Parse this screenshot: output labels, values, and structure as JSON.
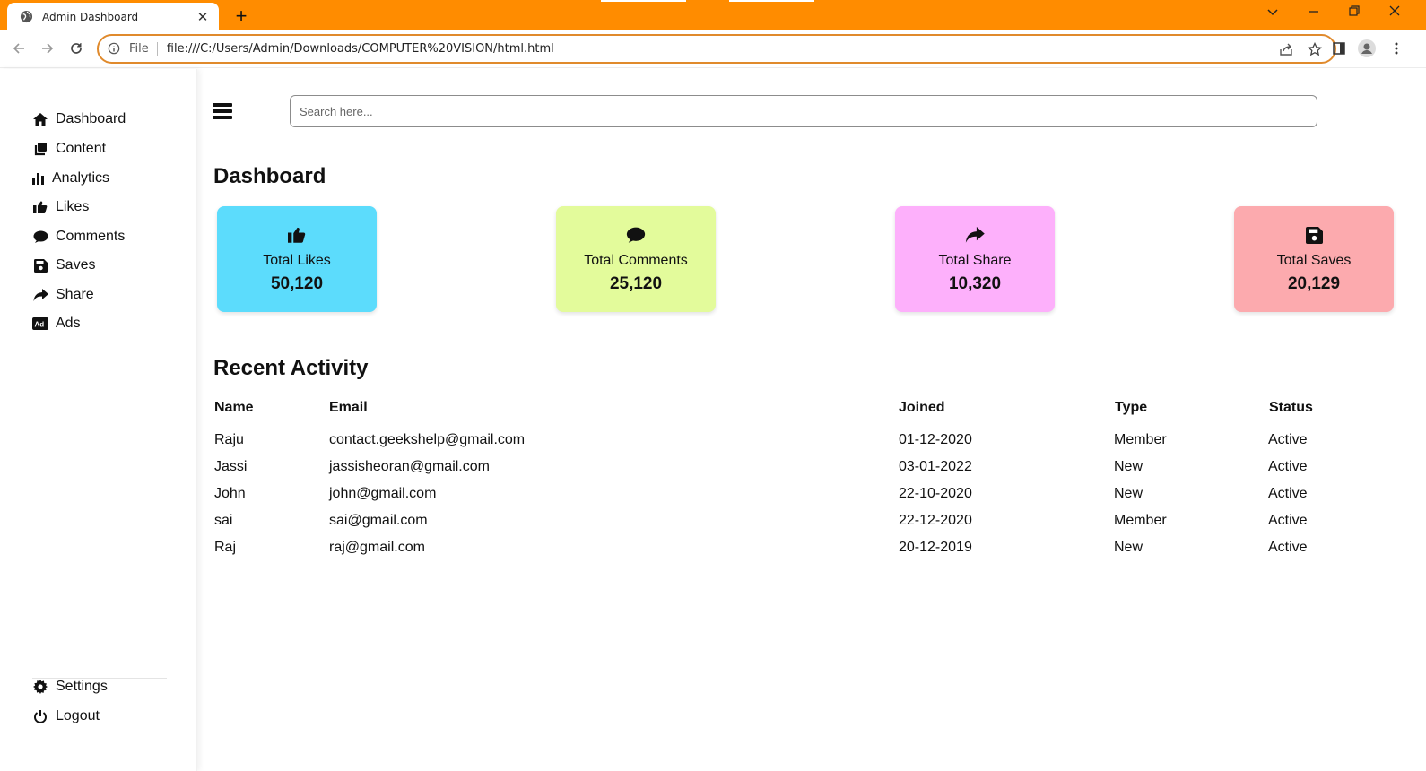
{
  "browser": {
    "tab_title": "Admin Dashboard",
    "tab_close": "✕",
    "new_tab": "+",
    "scheme_label": "File",
    "url": "file:///C:/Users/Admin/Downloads/COMPUTER%20VISION/html.html",
    "accent_color": "#ff8c00"
  },
  "sidebar": {
    "items": [
      {
        "label": "Dashboard",
        "icon": "home-icon"
      },
      {
        "label": "Content",
        "icon": "copy-icon"
      },
      {
        "label": "Analytics",
        "icon": "bar-chart-icon"
      },
      {
        "label": "Likes",
        "icon": "thumbs-up-icon"
      },
      {
        "label": "Comments",
        "icon": "comment-icon"
      },
      {
        "label": "Saves",
        "icon": "floppy-disk-icon"
      },
      {
        "label": "Share",
        "icon": "share-icon"
      },
      {
        "label": "Ads",
        "icon": "ad-icon"
      }
    ],
    "bottom_items": [
      {
        "label": "Settings",
        "icon": "gear-icon"
      },
      {
        "label": "Logout",
        "icon": "power-icon"
      }
    ]
  },
  "header": {
    "search_placeholder": "Search here..."
  },
  "dashboard": {
    "title": "Dashboard",
    "cards": [
      {
        "label": "Total Likes",
        "value": "50,120",
        "icon": "thumbs-up-icon",
        "color": "#5cdcfc"
      },
      {
        "label": "Total Comments",
        "value": "25,120",
        "icon": "comment-icon",
        "color": "#e3fb9b"
      },
      {
        "label": "Total Share",
        "value": "10,320",
        "icon": "share-icon",
        "color": "#fdb0fb"
      },
      {
        "label": "Total Saves",
        "value": "20,129",
        "icon": "floppy-disk-icon",
        "color": "#fcaaae"
      }
    ]
  },
  "activity": {
    "title": "Recent Activity",
    "columns": [
      "Name",
      "Email",
      "Joined",
      "Type",
      "Status"
    ],
    "rows": [
      [
        "Raju",
        "contact.geekshelp@gmail.com",
        "01-12-2020",
        "Member",
        "Active"
      ],
      [
        "Jassi",
        "jassisheoran@gmail.com",
        "03-01-2022",
        "New",
        "Active"
      ],
      [
        "John",
        "john@gmail.com",
        "22-10-2020",
        "New",
        "Active"
      ],
      [
        "sai",
        "sai@gmail.com",
        "22-12-2020",
        "Member",
        "Active"
      ],
      [
        "Raj",
        "raj@gmail.com",
        "20-12-2019",
        "New",
        "Active"
      ]
    ]
  }
}
